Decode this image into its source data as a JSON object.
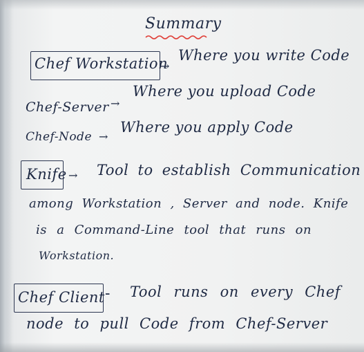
{
  "title": "Summary",
  "lines": [
    {
      "term": "Chef Workstation",
      "sep": "→",
      "text": "Where you write Code"
    },
    {
      "term": "Chef-Server",
      "sep": "→",
      "text": "Where you upload Code"
    },
    {
      "term": "Chef-Node",
      "sep": "→",
      "text": "Where you apply Code"
    }
  ],
  "knife": {
    "term": "Knife",
    "sep": "→",
    "line1": "Tool to establish Communication",
    "line2": "among Workstation , Server and node. Knife",
    "line3": "is a Command-Line tool that runs on",
    "line4": "Workstation."
  },
  "client": {
    "term": "Chef Client",
    "sep": "-",
    "line1": "Tool runs on every Chef",
    "line2": "node to pull Code from Chef-Server"
  },
  "colors": {
    "ink": "#1f2a44",
    "underline": "#e0413a",
    "board": "#f1f2f2"
  }
}
